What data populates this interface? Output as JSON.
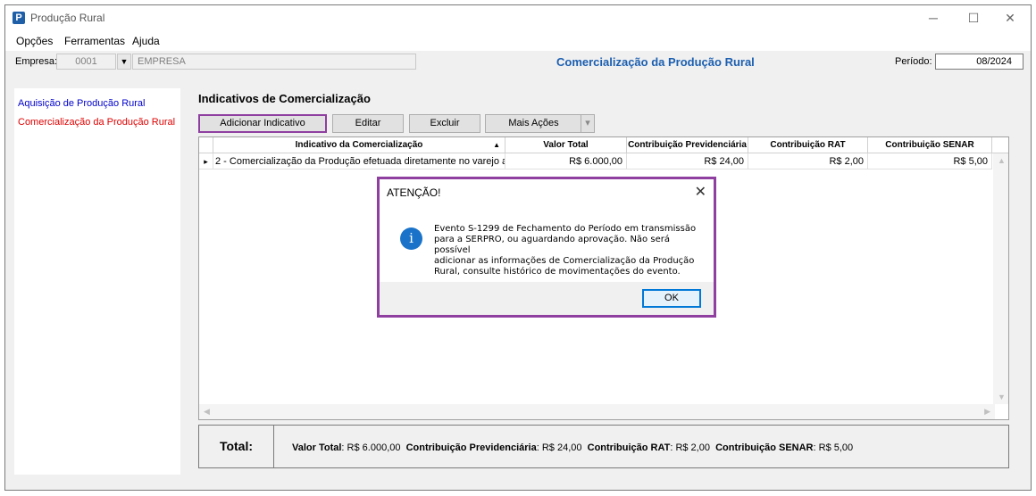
{
  "window": {
    "title": "Produção Rural",
    "minimize": "─",
    "maximize": "☐",
    "close": "✕",
    "icon_letter": "P"
  },
  "menu": [
    "Opções",
    "Ferramentas",
    "Ajuda"
  ],
  "empresa": {
    "label": "Empresa:",
    "code": "0001",
    "name": "EMPRESA",
    "dropdown_glyph": "▼"
  },
  "header": {
    "title": "Comercialização da Produção Rural",
    "periodo_label": "Período:",
    "periodo_value": "08/2024"
  },
  "sidebar": {
    "items": [
      {
        "label": "Aquisição de Produção Rural",
        "color": "#0000cc"
      },
      {
        "label": "Comercialização da Produção Rural",
        "color": "#e00000"
      }
    ]
  },
  "section": {
    "title": "Indicativos de Comercialização"
  },
  "toolbar": {
    "add": "Adicionar Indicativo",
    "edit": "Editar",
    "delete": "Excluir",
    "more": "Mais Ações",
    "more_arrow": "▾"
  },
  "table": {
    "columns": [
      "Indicativo da Comercialização",
      "Valor Total",
      "Contribuição Previdenciária",
      "Contribuição RAT",
      "Contribuição SENAR"
    ],
    "sort_glyph": "▲",
    "rows": [
      {
        "marker": "▸",
        "indicativo": "2 - Comercialização da Produção efetuada diretamente no varejo a...",
        "valor_total": "R$ 6.000,00",
        "prev": "R$ 24,00",
        "rat": "R$ 2,00",
        "senar": "R$ 5,00"
      }
    ]
  },
  "totals": {
    "label": "Total:",
    "valor_total_label": "Valor Total",
    "valor_total": "R$ 6.000,00",
    "prev_label": "Contribuição Previdenciária",
    "prev": "R$ 24,00",
    "rat_label": "Contribuição RAT",
    "rat": "R$ 2,00",
    "senar_label": "Contribuição SENAR",
    "senar": "R$ 5,00"
  },
  "dialog": {
    "title": "ATENÇÃO!",
    "close": "✕",
    "icon_glyph": "i",
    "message_lines": [
      "Evento S-1299 de Fechamento do Período em transmissão",
      "para a SERPRO, ou aguardando aprovação. Não será possível",
      "adicionar as informações de Comercialização da Produção",
      "Rural, consulte histórico de movimentações do evento."
    ],
    "ok": "OK"
  },
  "colors": {
    "accent_blue": "#1c5fb0",
    "highlight": "#8e3fa0"
  }
}
